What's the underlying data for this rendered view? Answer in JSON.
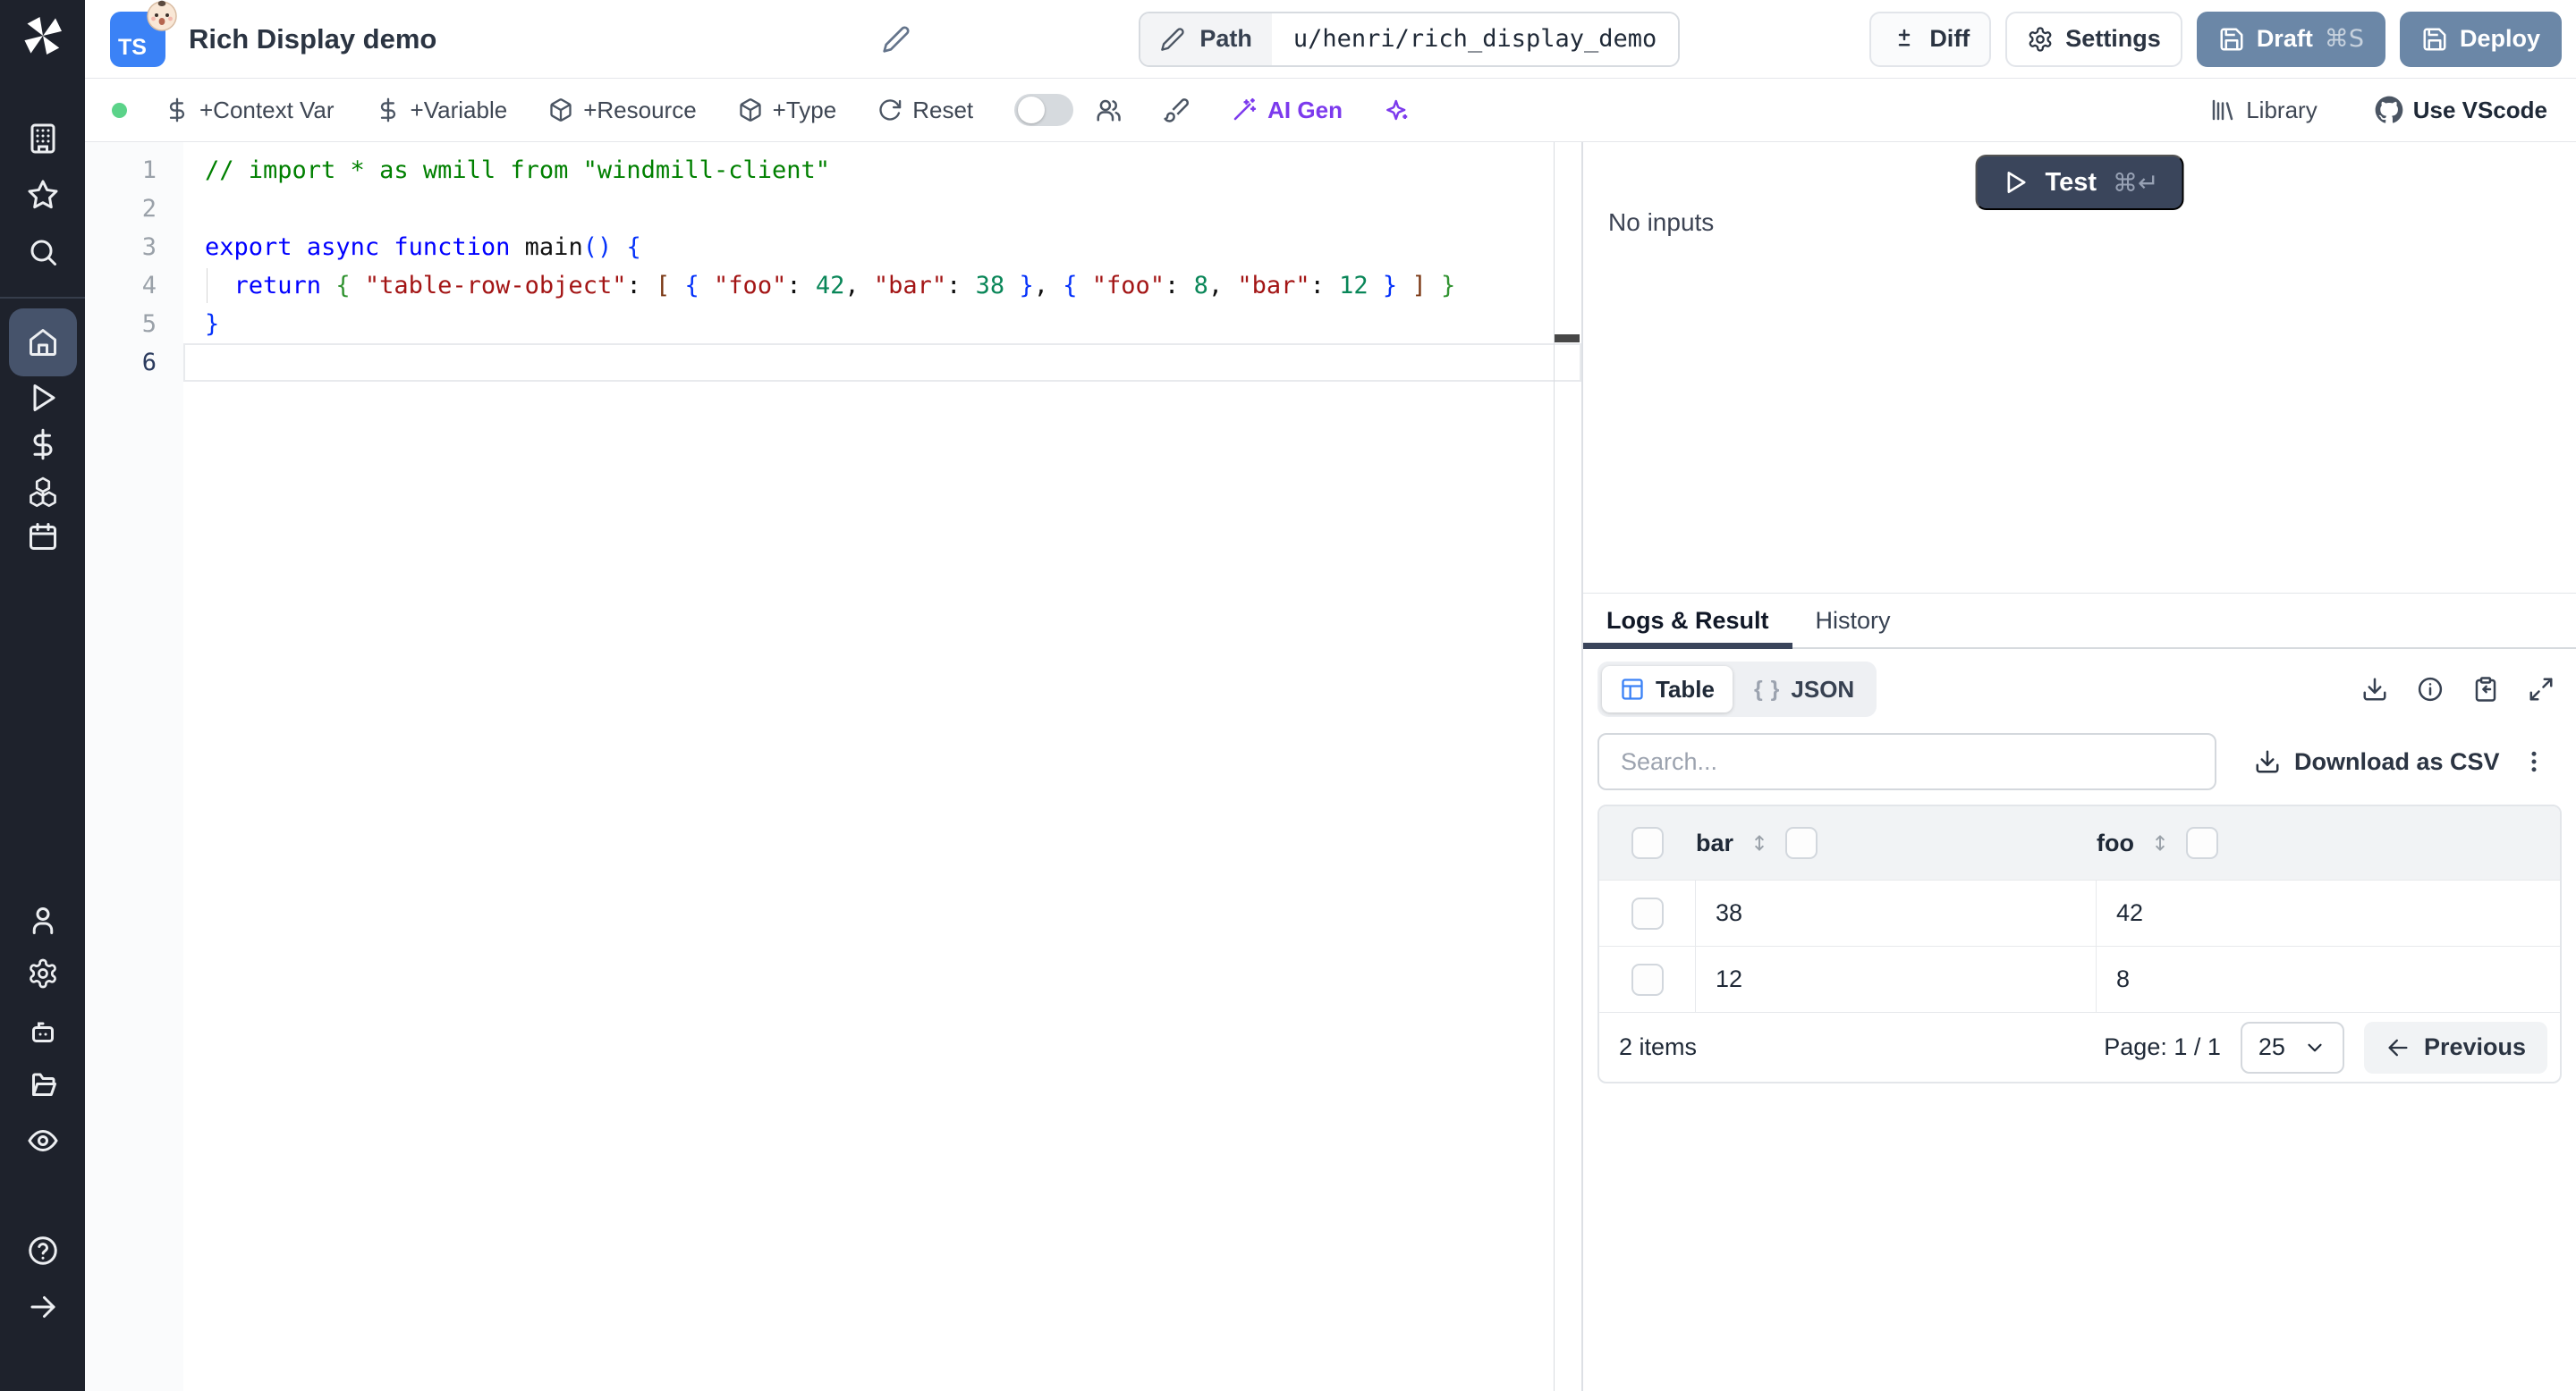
{
  "colors": {
    "sidebar_bg": "#1e222c",
    "sidebar_active": "#46536b",
    "badge_blue": "#3b82f6",
    "action_blue": "#6b87a7",
    "test_navy": "#3a455b",
    "accent_purple": "#7c3aed",
    "status_green": "#5bd389",
    "table_icon_blue": "#3b82f6"
  },
  "sidebar": {
    "icons": [
      "windmill-logo",
      "building",
      "star",
      "search",
      "home",
      "play",
      "dollar",
      "boxes",
      "calendar",
      "user",
      "gear",
      "bot",
      "folder-open",
      "eye",
      "help-circle",
      "arrow-right"
    ],
    "active_item": "home"
  },
  "header": {
    "lang_badge": "TS",
    "badge_emoji": "baby-face",
    "title": "Rich Display demo",
    "path_label": "Path",
    "path_value": "u/henri/rich_display_demo",
    "diff": "Diff",
    "settings": "Settings",
    "draft": "Draft",
    "draft_shortcut": "⌘S",
    "deploy": "Deploy"
  },
  "toolbar": {
    "context_var": "+Context Var",
    "variable": "+Variable",
    "resource": "+Resource",
    "type": "+Type",
    "reset": "Reset",
    "ai_gen": "AI Gen",
    "library": "Library",
    "use_vscode": "Use VScode",
    "icons": [
      "status-dot",
      "dollar",
      "dollar",
      "package",
      "package",
      "rotate-cw",
      "toggle-off",
      "users",
      "paintbrush",
      "wand-sparkles",
      "sparkles",
      "library",
      "github"
    ]
  },
  "editor": {
    "lines": [
      {
        "n": "1",
        "tokens": [
          {
            "t": "// import * as wmill from \"windmill-client\"",
            "c": "cm"
          }
        ]
      },
      {
        "n": "2",
        "tokens": []
      },
      {
        "n": "3",
        "tokens": [
          {
            "t": "export",
            "c": "kw"
          },
          {
            "t": " ",
            "c": "pl"
          },
          {
            "t": "async",
            "c": "kw"
          },
          {
            "t": " ",
            "c": "pl"
          },
          {
            "t": "function",
            "c": "kw"
          },
          {
            "t": " ",
            "c": "pl"
          },
          {
            "t": "main",
            "c": "pl"
          },
          {
            "t": "(",
            "c": "b1"
          },
          {
            "t": ")",
            "c": "b1"
          },
          {
            "t": " ",
            "c": "pl"
          },
          {
            "t": "{",
            "c": "b1"
          }
        ]
      },
      {
        "n": "4",
        "guide": true,
        "tokens": [
          {
            "t": "  ",
            "c": "pl"
          },
          {
            "t": "return",
            "c": "kw"
          },
          {
            "t": " ",
            "c": "pl"
          },
          {
            "t": "{",
            "c": "b2"
          },
          {
            "t": " ",
            "c": "pl"
          },
          {
            "t": "\"table-row-object\"",
            "c": "s"
          },
          {
            "t": ": ",
            "c": "pl"
          },
          {
            "t": "[",
            "c": "b3"
          },
          {
            "t": " ",
            "c": "pl"
          },
          {
            "t": "{",
            "c": "b1"
          },
          {
            "t": " ",
            "c": "pl"
          },
          {
            "t": "\"foo\"",
            "c": "s"
          },
          {
            "t": ": ",
            "c": "pl"
          },
          {
            "t": "42",
            "c": "n"
          },
          {
            "t": ", ",
            "c": "pl"
          },
          {
            "t": "\"bar\"",
            "c": "s"
          },
          {
            "t": ": ",
            "c": "pl"
          },
          {
            "t": "38",
            "c": "n"
          },
          {
            "t": " ",
            "c": "pl"
          },
          {
            "t": "}",
            "c": "b1"
          },
          {
            "t": ", ",
            "c": "pl"
          },
          {
            "t": "{",
            "c": "b1"
          },
          {
            "t": " ",
            "c": "pl"
          },
          {
            "t": "\"foo\"",
            "c": "s"
          },
          {
            "t": ": ",
            "c": "pl"
          },
          {
            "t": "8",
            "c": "n"
          },
          {
            "t": ", ",
            "c": "pl"
          },
          {
            "t": "\"bar\"",
            "c": "s"
          },
          {
            "t": ": ",
            "c": "pl"
          },
          {
            "t": "12",
            "c": "n"
          },
          {
            "t": " ",
            "c": "pl"
          },
          {
            "t": "}",
            "c": "b1"
          },
          {
            "t": " ",
            "c": "pl"
          },
          {
            "t": "]",
            "c": "b3"
          },
          {
            "t": " ",
            "c": "pl"
          },
          {
            "t": "}",
            "c": "b2"
          }
        ]
      },
      {
        "n": "5",
        "tokens": [
          {
            "t": "}",
            "c": "b1"
          }
        ]
      },
      {
        "n": "6",
        "active": true,
        "tokens": []
      }
    ]
  },
  "run_panel": {
    "test_label": "Test",
    "test_shortcut": "⌘↵",
    "no_inputs": "No inputs"
  },
  "results": {
    "tabs": [
      {
        "label": "Logs & Result"
      },
      {
        "label": "History"
      }
    ],
    "views": [
      {
        "label": "Table"
      },
      {
        "label": "JSON"
      }
    ],
    "json_glyph": "{ }",
    "action_icons": [
      "download",
      "info-circle",
      "clipboard-copy",
      "maximize"
    ],
    "search_placeholder": "Search...",
    "download_csv": "Download as CSV",
    "table": {
      "columns": [
        "bar",
        "foo"
      ],
      "rows": [
        [
          "38",
          "42"
        ],
        [
          "12",
          "8"
        ]
      ],
      "items_text": "2 items",
      "page_text": "Page: 1 / 1",
      "page_size": "25",
      "previous_label": "Previous"
    }
  }
}
